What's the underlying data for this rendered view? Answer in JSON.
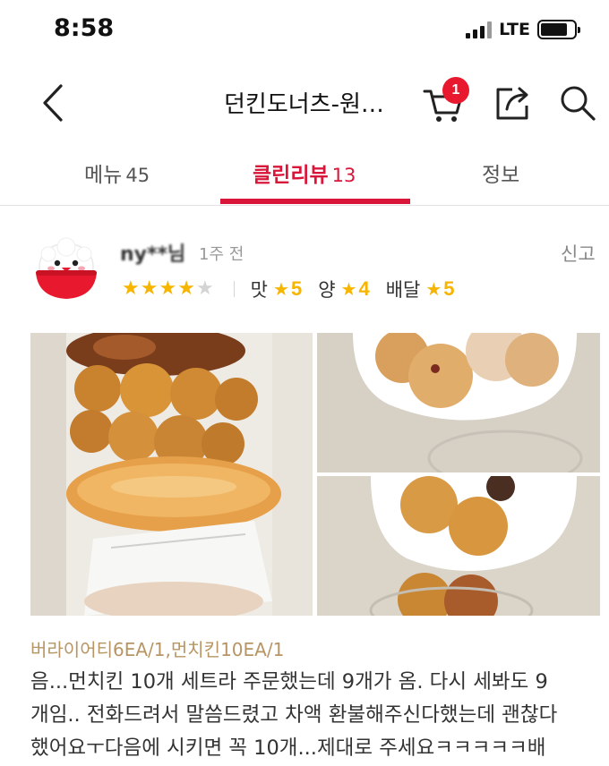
{
  "status_bar": {
    "time": "8:58",
    "network": "LTE",
    "battery_level": 0.8,
    "icons": [
      "signal-icon",
      "battery-icon"
    ]
  },
  "header": {
    "back_icon": "chevron-left-icon",
    "title": "던킨도너츠-원…",
    "cart_icon": "cart-icon",
    "cart_badge": "1",
    "share_icon": "share-icon",
    "search_icon": "search-icon",
    "accent_color": "#e8192e"
  },
  "tabs": [
    {
      "label": "메뉴",
      "count": "45"
    },
    {
      "label": "클린리뷰",
      "count": "13",
      "active": true
    },
    {
      "label": "정보",
      "count": ""
    }
  ],
  "review": {
    "reviewer": "ny**님",
    "time": "1주 전",
    "report_label": "신고",
    "rating": 4,
    "rating_max": 5,
    "sub_ratings": [
      {
        "label": "맛",
        "value": "5"
      },
      {
        "label": "양",
        "value": "4"
      },
      {
        "label": "배달",
        "value": "5"
      }
    ],
    "photos": [
      "donut-box-photo",
      "donut-cup-photo",
      "munchkin-cup-photo"
    ],
    "order_items": "버라이어티6EA/1,먼치킨10EA/1",
    "text_lines": [
      "음...먼치킨 10개 세트라 주문했는데 9개가 옴. 다시 세봐도 9",
      "개임.. 전화드려서 말씀드렸고 차액 환불해주신다했는데 괜찮다",
      "했어요ㅜ다음에 시키면 꼭 10개...제대로 주세요ㅋㅋㅋㅋㅋ배"
    ]
  },
  "colors": {
    "brand_red": "#d9163a",
    "star_yellow": "#f7b500",
    "order_text": "#b79564"
  }
}
